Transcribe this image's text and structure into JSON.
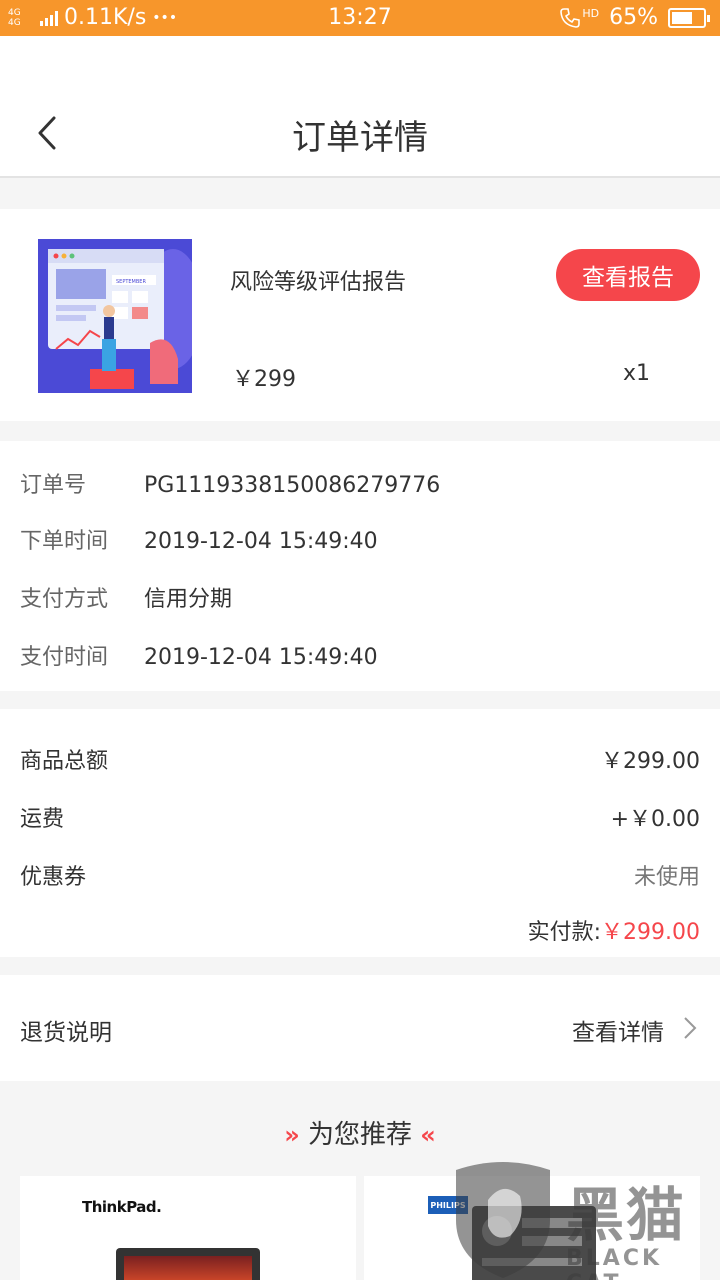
{
  "status_bar": {
    "network_label": "4G 4G",
    "speed": "0.11K/s",
    "dots": "•••",
    "time": "13:27",
    "hd_label": "HD",
    "battery": "65%",
    "battery_level": 0.65
  },
  "header": {
    "title": "订单详情"
  },
  "product": {
    "name": "风险等级评估报告",
    "image_text": "SEPTEMBER",
    "view_report_label": "查看报告",
    "price": "￥299",
    "quantity": "x1"
  },
  "order_info": [
    {
      "label": "订单号",
      "value": "PG1119338150086279776"
    },
    {
      "label": "下单时间",
      "value": "2019-12-04 15:49:40"
    },
    {
      "label": "支付方式",
      "value": "信用分期"
    },
    {
      "label": "支付时间",
      "value": "2019-12-04 15:49:40"
    }
  ],
  "amounts": {
    "rows": [
      {
        "label": "商品总额",
        "value": "￥299.00"
      },
      {
        "label": "运费",
        "value": "+￥0.00"
      },
      {
        "label": "优惠券",
        "value": "未使用"
      }
    ],
    "paid_label": "实付款:",
    "paid_value": "￥299.00"
  },
  "returns": {
    "label": "退货说明",
    "link_label": "查看详情"
  },
  "recommend": {
    "title": "为您推荐",
    "left_arrows": "»",
    "right_arrows": "«",
    "items": [
      {
        "brand": "ThinkPad."
      },
      {
        "brand": "PHILIPS"
      }
    ]
  },
  "watermark": {
    "text": "黑猫",
    "sub": "BLACK CAT"
  },
  "colors": {
    "status_bar": "#f7962b",
    "accent_red": "#f5464b"
  }
}
